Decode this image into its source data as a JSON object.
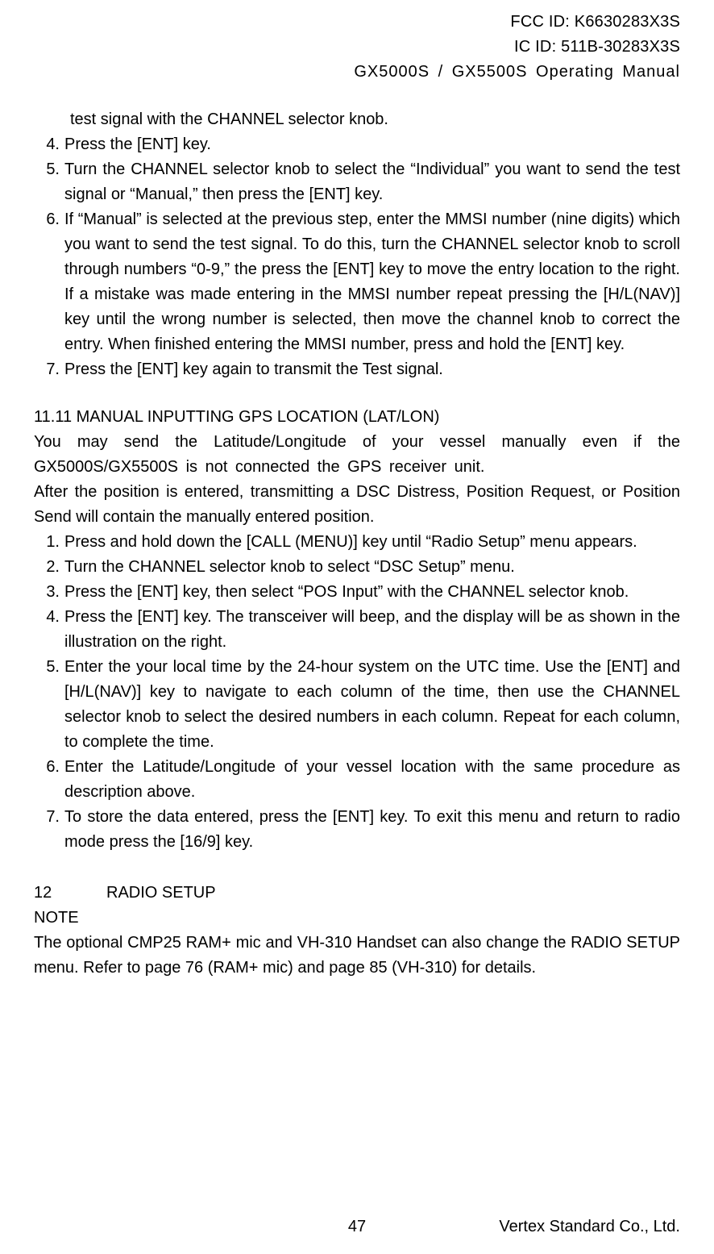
{
  "header": {
    "fcc_id": "FCC ID: K6630283X3S",
    "ic_id": "IC ID: 511B-30283X3S",
    "model_line": "GX5000S / GX5500S   Operating Manual"
  },
  "body": {
    "orphan_continuation": "test signal with the CHANNEL selector knob.",
    "listA": [
      {
        "n": "4.",
        "text": "Press the [ENT] key."
      },
      {
        "n": "5.",
        "text": "Turn the CHANNEL selector knob to select the “Individual” you want to send the test signal or “Manual,” then press the [ENT] key."
      },
      {
        "n": "6.",
        "text": "If “Manual” is selected at the previous step, enter the MMSI number (nine digits) which you want to send the test signal. To do this, turn the CHANNEL selector knob to scroll through numbers “0-9,” the press the [ENT] key to move the entry location to the right. If a mistake was made entering in the MMSI number repeat pressing the [H/L(NAV)] key until the wrong number is selected, then move the channel knob to correct the entry. When finished entering the MMSI number, press and hold the [ENT] key."
      },
      {
        "n": "7.",
        "text": "Press the [ENT] key again to transmit the Test signal."
      }
    ],
    "section_11_11_title": "11.11 MANUAL INPUTTING GPS LOCATION (LAT/LON)",
    "section_11_11_p1": "You may send the Latitude/Longitude of your vessel manually even if the GX5000S/GX5500S is not connected the GPS receiver unit.",
    "section_11_11_p2": "After the position is entered, transmitting a DSC Distress, Position Request, or Position Send will contain the manually entered position.",
    "listB": [
      {
        "n": "1.",
        "text": "Press and hold down the [CALL (MENU)] key until “Radio Setup” menu appears."
      },
      {
        "n": "2.",
        "text": "Turn the CHANNEL selector knob to select “DSC Setup” menu."
      },
      {
        "n": "3.",
        "text": "Press the [ENT] key, then select “POS Input” with the CHANNEL selector knob."
      },
      {
        "n": "4.",
        "text": "Press the [ENT] key. The transceiver will beep, and the display will be as shown in the illustration on the right."
      },
      {
        "n": "5.",
        "text": "Enter the your local time by the 24-hour system on the UTC time. Use the [ENT] and [H/L(NAV)] key to navigate to each column of the time, then use the CHANNEL selector knob to select the desired numbers in each column. Repeat for each column, to complete the time."
      },
      {
        "n": "6.",
        "text": "Enter the Latitude/Longitude of your vessel location with the same procedure as description above."
      },
      {
        "n": "7.",
        "text": "To store the data entered, press the [ENT] key. To exit this menu and return to radio mode press the [16/9] key."
      }
    ],
    "section_12_no": "12",
    "section_12_title": "RADIO SETUP",
    "note_label": "NOTE",
    "note_body": "The optional CMP25 RAM+ mic and VH-310 Handset can also change the RADIO SETUP menu. Refer to page 76 (RAM+ mic) and page 85 (VH-310) for details."
  },
  "footer": {
    "page_number": "47",
    "company": "Vertex Standard Co., Ltd."
  }
}
